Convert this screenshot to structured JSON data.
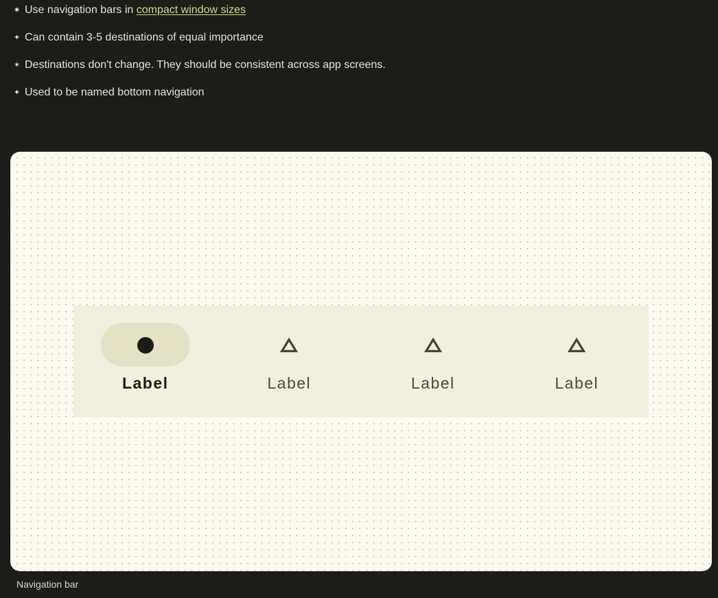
{
  "bullets": [
    {
      "icon": "sparkle-icon",
      "glyph": "✷",
      "text": "Use navigation bars in ",
      "link": "compact window sizes"
    },
    {
      "icon": "sparkle-icon",
      "glyph": "✦",
      "text": "Can contain 3-5 destinations of equal importance"
    },
    {
      "icon": "sparkle-icon",
      "glyph": "✶",
      "text": "Destinations don't change. They should be consistent across app screens."
    },
    {
      "icon": "sparkle-icon",
      "glyph": "✦",
      "text": "Used to be named bottom navigation"
    }
  ],
  "navbar": {
    "items": [
      {
        "label": "Label",
        "icon": "circle-icon",
        "active": true
      },
      {
        "label": "Label",
        "icon": "triangle-icon",
        "active": false
      },
      {
        "label": "Label",
        "icon": "triangle-icon",
        "active": false
      },
      {
        "label": "Label",
        "icon": "triangle-icon",
        "active": false
      }
    ]
  },
  "colors": {
    "background": "#1c1d18",
    "panel": "#fdfaf1",
    "navbar": "#f1efdf",
    "indicator": "#e3e2c4",
    "link": "#d5d98a"
  },
  "caption": "Navigation bar"
}
